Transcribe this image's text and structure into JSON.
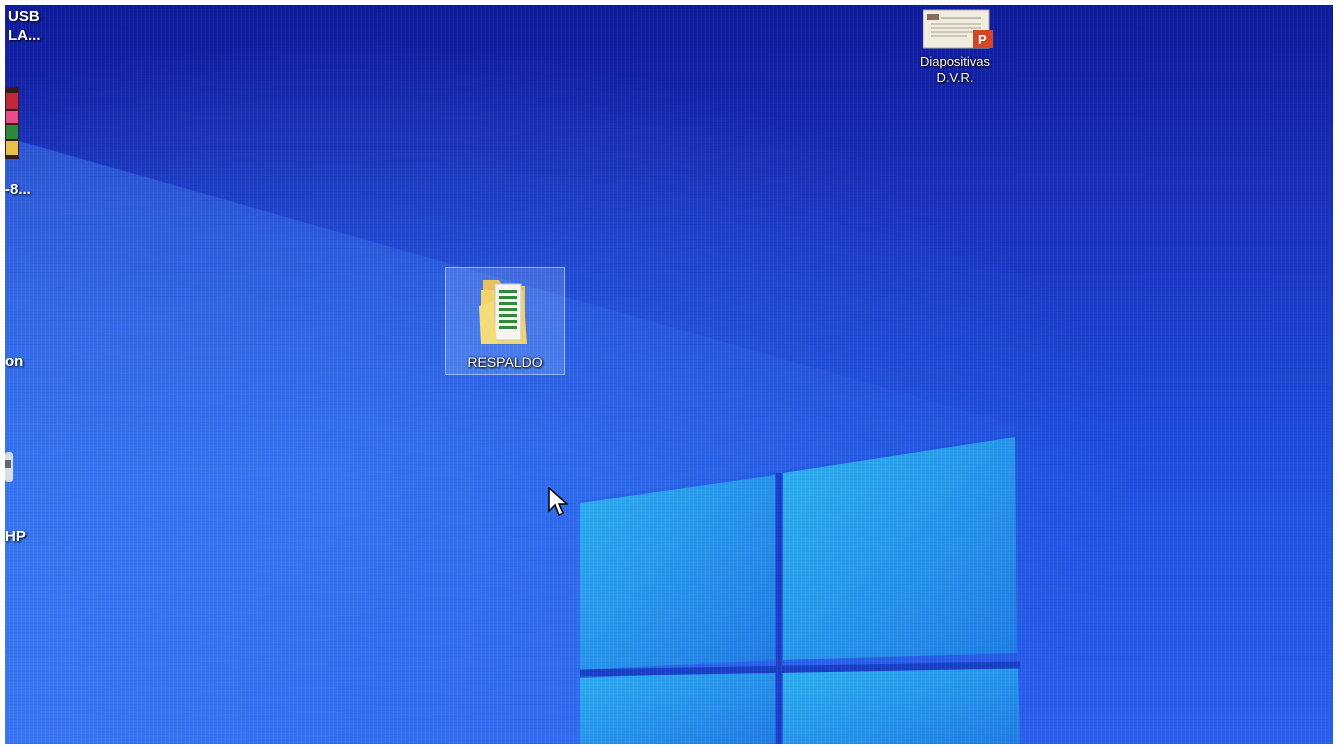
{
  "desktop": {
    "icons": [
      {
        "label": "RESPALDO",
        "icon": "folder-icon",
        "selected": true
      },
      {
        "label_line1": "Diapositivas",
        "label_line2": "D.V.R.",
        "icon": "powerpoint-file-icon"
      }
    ],
    "partial_left_icons": [
      {
        "label_line1": "USB",
        "label_line2": "LA..."
      },
      {
        "label": "-8..."
      },
      {
        "label": "on"
      },
      {
        "label": "HP"
      }
    ]
  },
  "colors": {
    "wallpaper_top": "#0f1a9c",
    "wallpaper_bottom": "#2a5ff0",
    "window_logo": "#2fb0f0",
    "selection": "#a0c8ff"
  }
}
